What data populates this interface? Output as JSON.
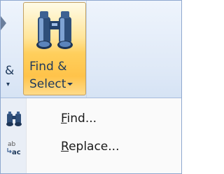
{
  "ribbon": {
    "left_group": {
      "label_fragment": "&"
    },
    "find_select": {
      "label_line1": "Find &",
      "label_line2": "Select"
    }
  },
  "menu": {
    "items": [
      {
        "label_mnemonic": "F",
        "label_rest": "ind...",
        "icon": "binoculars-icon"
      },
      {
        "label_mnemonic": "R",
        "label_rest": "eplace...",
        "icon": "replace-ab-ac-icon"
      }
    ]
  },
  "colors": {
    "ribbon_bg": "#dfe9f7",
    "button_hover": "#ffcf5c",
    "text": "#1e395b",
    "frame": "#8fa8cf"
  }
}
